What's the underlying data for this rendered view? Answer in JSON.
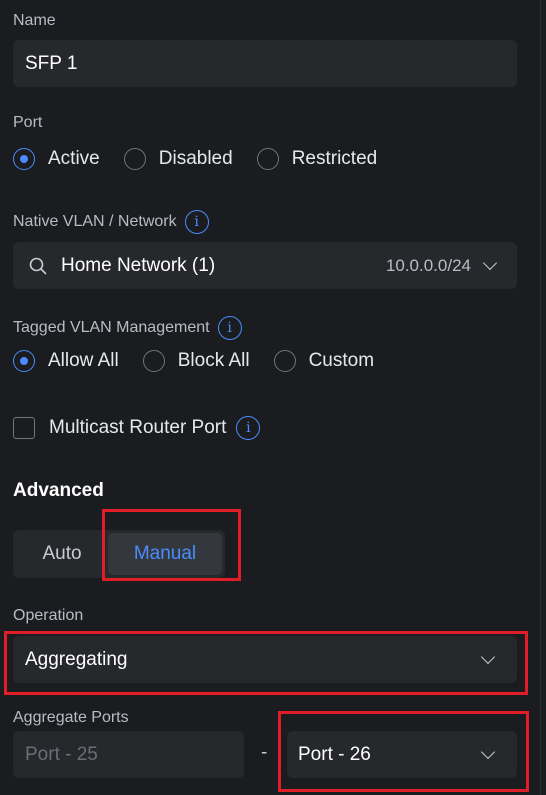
{
  "name_section": {
    "label": "Name",
    "value": "SFP 1"
  },
  "port_section": {
    "label": "Port",
    "options": [
      "Active",
      "Disabled",
      "Restricted"
    ],
    "selected": "Active"
  },
  "native_vlan": {
    "label": "Native VLAN / Network",
    "info": "i",
    "value": "Home Network (1)",
    "subnet": "10.0.0.0/24"
  },
  "tagged_vlan": {
    "label": "Tagged VLAN Management",
    "info": "i",
    "options": [
      "Allow All",
      "Block All",
      "Custom"
    ],
    "selected": "Allow All"
  },
  "multicast": {
    "label": "Multicast Router Port",
    "info": "i",
    "checked": false
  },
  "advanced": {
    "heading": "Advanced",
    "modes": [
      "Auto",
      "Manual"
    ],
    "selected_mode": "Manual"
  },
  "operation": {
    "label": "Operation",
    "value": "Aggregating"
  },
  "aggregate": {
    "label": "Aggregate Ports",
    "start_port": "Port - 25",
    "separator": "-",
    "end_port": "Port - 26"
  },
  "colors": {
    "background": "#1b1c1f",
    "field": "#26282c",
    "accent": "#4a8cff",
    "highlight": "#e01e28"
  }
}
